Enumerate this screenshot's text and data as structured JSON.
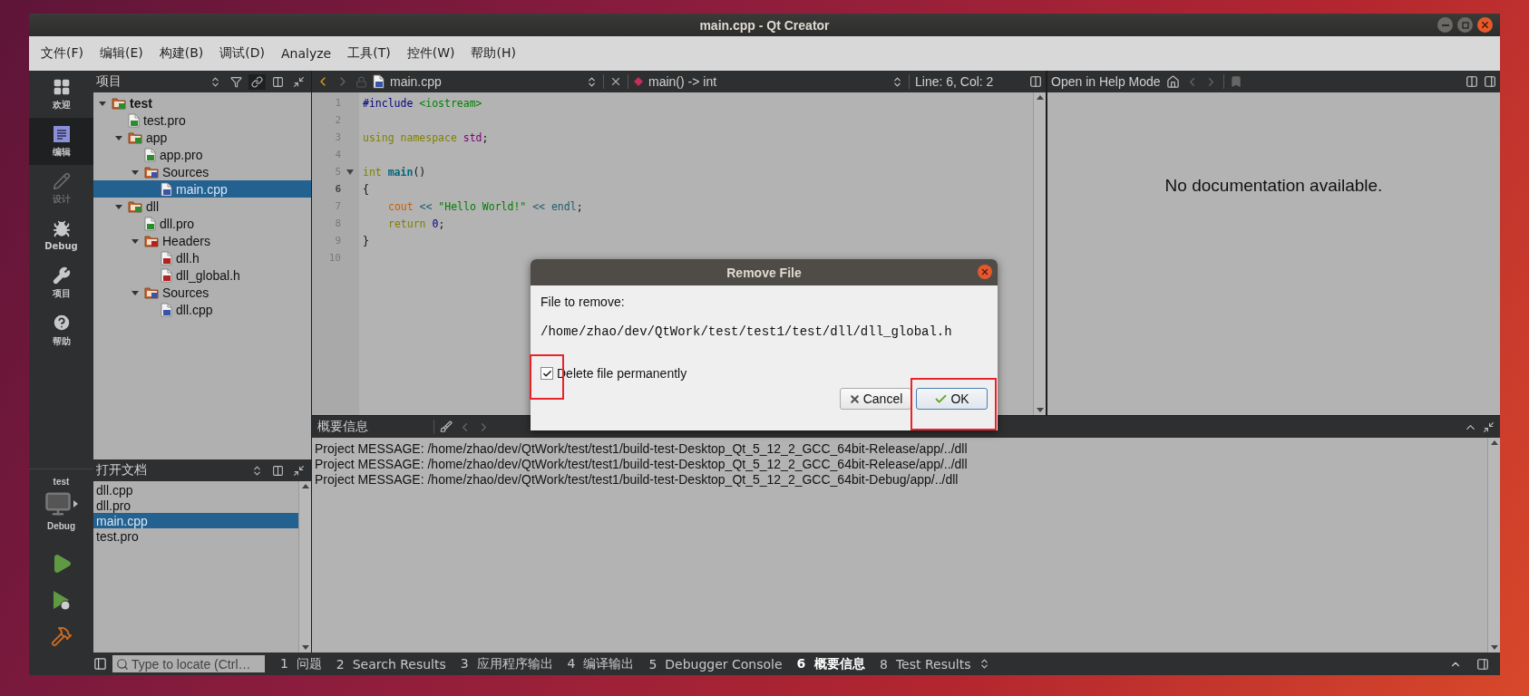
{
  "window": {
    "title": "main.cpp - Qt Creator"
  },
  "menu": [
    "文件(F)",
    "编辑(E)",
    "构建(B)",
    "调试(D)",
    "Analyze",
    "工具(T)",
    "控件(W)",
    "帮助(H)"
  ],
  "modes": [
    {
      "label": "欢迎",
      "kind": "grid",
      "selected": false,
      "disabled": false
    },
    {
      "label": "编辑",
      "kind": "edit",
      "selected": true,
      "disabled": false
    },
    {
      "label": "设计",
      "kind": "pencil",
      "selected": false,
      "disabled": true
    },
    {
      "label": "Debug",
      "kind": "bug",
      "selected": false,
      "disabled": false
    },
    {
      "label": "项目",
      "kind": "wrench",
      "selected": false,
      "disabled": false
    },
    {
      "label": "帮助",
      "kind": "help",
      "selected": false,
      "disabled": false
    }
  ],
  "kit": {
    "project": "test",
    "build": "Debug"
  },
  "project_panel": {
    "title": "项目",
    "tree": [
      {
        "label": "test",
        "kind": "project",
        "expanded": true,
        "selected": false,
        "children": [
          {
            "label": "test.pro",
            "kind": "pro",
            "selected": false
          },
          {
            "label": "app",
            "kind": "project",
            "expanded": true,
            "selected": false,
            "children": [
              {
                "label": "app.pro",
                "kind": "pro",
                "selected": false
              },
              {
                "label": "Sources",
                "kind": "sources",
                "expanded": true,
                "selected": false,
                "children": [
                  {
                    "label": "main.cpp",
                    "kind": "cpp",
                    "selected": true
                  }
                ]
              }
            ]
          },
          {
            "label": "dll",
            "kind": "project",
            "expanded": true,
            "selected": false,
            "children": [
              {
                "label": "dll.pro",
                "kind": "pro",
                "selected": false
              },
              {
                "label": "Headers",
                "kind": "headers",
                "expanded": true,
                "selected": false,
                "children": [
                  {
                    "label": "dll.h",
                    "kind": "h",
                    "selected": false
                  },
                  {
                    "label": "dll_global.h",
                    "kind": "h",
                    "selected": false
                  }
                ]
              },
              {
                "label": "Sources",
                "kind": "sources",
                "expanded": true,
                "selected": false,
                "children": [
                  {
                    "label": "dll.cpp",
                    "kind": "cpp",
                    "selected": false
                  }
                ]
              }
            ]
          }
        ]
      }
    ]
  },
  "open_documents": {
    "title": "打开文档",
    "items": [
      {
        "label": "dll.cpp",
        "selected": false
      },
      {
        "label": "dll.pro",
        "selected": false
      },
      {
        "label": "main.cpp",
        "selected": true
      },
      {
        "label": "test.pro",
        "selected": false
      }
    ]
  },
  "editor": {
    "file": "main.cpp",
    "symbol": "main() -> int",
    "position": "Line: 6, Col: 2",
    "lines": [
      {
        "number": "1",
        "current": false,
        "foldable": false,
        "indented": false,
        "tokens": [
          {
            "text": "#include",
            "kind": "preproc"
          },
          {
            "text": "<iostream>",
            "kind": "string"
          }
        ]
      },
      {
        "number": "2",
        "current": false,
        "foldable": false
      },
      {
        "number": "3",
        "current": false,
        "foldable": false,
        "indented": false,
        "tokens": [
          {
            "text": "using namespace",
            "kind": "keyword"
          },
          {
            "text": "std",
            "kind": "namespace"
          },
          {
            "text": ";",
            "kind": "punct"
          }
        ]
      },
      {
        "number": "4",
        "current": false,
        "foldable": false
      },
      {
        "number": "5",
        "current": false,
        "foldable": true,
        "indented": false,
        "tokens": [
          {
            "text": "int",
            "kind": "keyword"
          },
          {
            "text": "main",
            "kind": "function"
          },
          {
            "text": "()",
            "kind": "punct"
          }
        ]
      },
      {
        "number": "6",
        "current": true,
        "foldable": false,
        "indented": false,
        "tokens": [
          {
            "text": "{",
            "kind": "punct"
          }
        ]
      },
      {
        "number": "7",
        "current": false,
        "foldable": false,
        "indented": true,
        "tokens": [
          {
            "text": "cout",
            "kind": "global"
          },
          {
            "text": "<<",
            "kind": "operator"
          },
          {
            "text": "\"Hello World!\"",
            "kind": "string"
          },
          {
            "text": "<< endl",
            "kind": "operator"
          },
          {
            "text": ";",
            "kind": "punct"
          }
        ]
      },
      {
        "number": "8",
        "current": false,
        "foldable": false,
        "indented": true,
        "tokens": [
          {
            "text": "return",
            "kind": "keyword"
          },
          {
            "text": "0",
            "kind": "number"
          },
          {
            "text": ";",
            "kind": "punct"
          }
        ]
      },
      {
        "number": "9",
        "current": false,
        "foldable": false,
        "indented": false,
        "tokens": [
          {
            "text": "}",
            "kind": "punct"
          }
        ]
      },
      {
        "number": "10",
        "current": false,
        "foldable": false
      }
    ]
  },
  "help": {
    "title": "Open in Help Mode",
    "message": "No documentation available."
  },
  "output": {
    "title": "概要信息",
    "lines": [
      "Project MESSAGE: /home/zhao/dev/QtWork/test/test1/build-test-Desktop_Qt_5_12_2_GCC_64bit-Release/app/../dll",
      "Project MESSAGE: /home/zhao/dev/QtWork/test/test1/build-test-Desktop_Qt_5_12_2_GCC_64bit-Release/app/../dll",
      "Project MESSAGE: /home/zhao/dev/QtWork/test/test1/build-test-Desktop_Qt_5_12_2_GCC_64bit-Debug/app/../dll"
    ]
  },
  "dialog": {
    "title": "Remove File",
    "label": "File to remove:",
    "path": "/home/zhao/dev/QtWork/test/test1/test/dll/dll_global.h",
    "checkbox": {
      "label": "Delete file permanently",
      "checked": true
    },
    "buttons": [
      {
        "label": "Cancel",
        "kind": "cancel",
        "default": false
      },
      {
        "label": "OK",
        "kind": "ok",
        "default": true
      }
    ]
  },
  "status_bar": {
    "locate_placeholder": "Type to locate (Ctrl…",
    "tabs": [
      {
        "number": "1",
        "label": "问题",
        "selected": false
      },
      {
        "number": "2",
        "label": "Search Results",
        "selected": false
      },
      {
        "number": "3",
        "label": "应用程序输出",
        "selected": false
      },
      {
        "number": "4",
        "label": "编译输出",
        "selected": false
      },
      {
        "number": "5",
        "label": "Debugger Console",
        "selected": false
      },
      {
        "number": "6",
        "label": "概要信息",
        "selected": true
      },
      {
        "number": "8",
        "label": "Test Results",
        "selected": false
      }
    ]
  }
}
